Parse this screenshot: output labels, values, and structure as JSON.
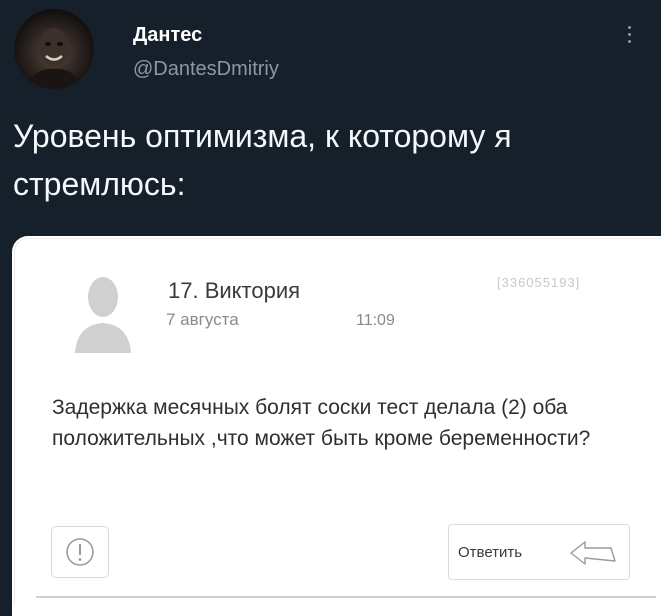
{
  "tweet": {
    "display_name": "Дантес",
    "handle": "@DantesDmitriy",
    "text": "Уровень оптимизма, к которому я стремлюсь:"
  },
  "screenshot_card": {
    "user_name": "17. Виктория",
    "date": "7 августа",
    "time": "11:09",
    "post_id": "[336055193]",
    "body": "Задержка месячных болят соски тест делала (2) оба положительных ,что может быть кроме беременности?",
    "reply_label": "Ответить"
  },
  "icons": {
    "avatar": "avatar",
    "more": "more-vertical-icon",
    "user": "user-silhouette-icon",
    "report": "exclamation-circle-icon",
    "reply": "reply-arrow-icon"
  },
  "colors": {
    "background": "#15202b",
    "text_primary": "#ffffff",
    "text_secondary": "#8b98a5",
    "card_background": "#ffffff"
  }
}
